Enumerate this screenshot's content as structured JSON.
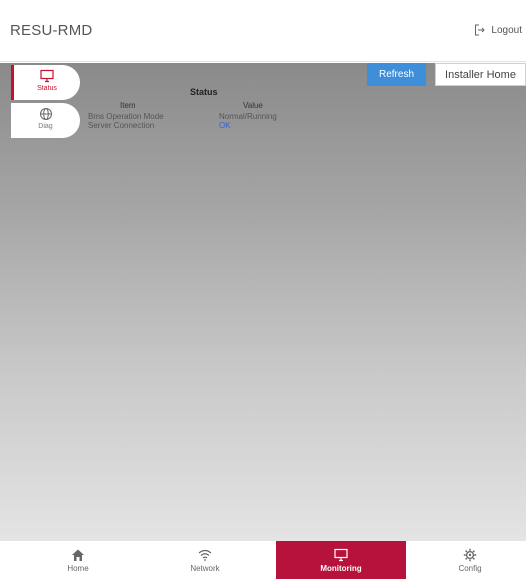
{
  "header": {
    "app_title": "RESU-RMD",
    "logout_label": "Logout"
  },
  "sidebar": {
    "items": [
      {
        "label": "Status",
        "icon": "monitor-icon",
        "active": true
      },
      {
        "label": "Diag",
        "icon": "globe-icon",
        "active": false
      }
    ]
  },
  "toolbar": {
    "refresh_label": "Refresh",
    "installer_home_label": "Installer Home"
  },
  "status": {
    "title": "Status",
    "col_item": "Item",
    "col_value": "Value",
    "rows": [
      {
        "item": "Bms Operation Mode",
        "value": "Normal/Running"
      },
      {
        "item": "Server Connection",
        "value": "OK"
      }
    ]
  },
  "bottom_nav": {
    "items": [
      {
        "label": "Home",
        "icon": "home-icon"
      },
      {
        "label": "Network",
        "icon": "wifi-icon"
      },
      {
        "label": "Monitoring",
        "icon": "monitor-icon",
        "active": true
      },
      {
        "label": "Config",
        "icon": "gear-icon"
      }
    ]
  },
  "colors": {
    "accent_red": "#c8102e",
    "refresh_blue": "#3e8ed9",
    "ok_blue": "#3b5fd3"
  }
}
